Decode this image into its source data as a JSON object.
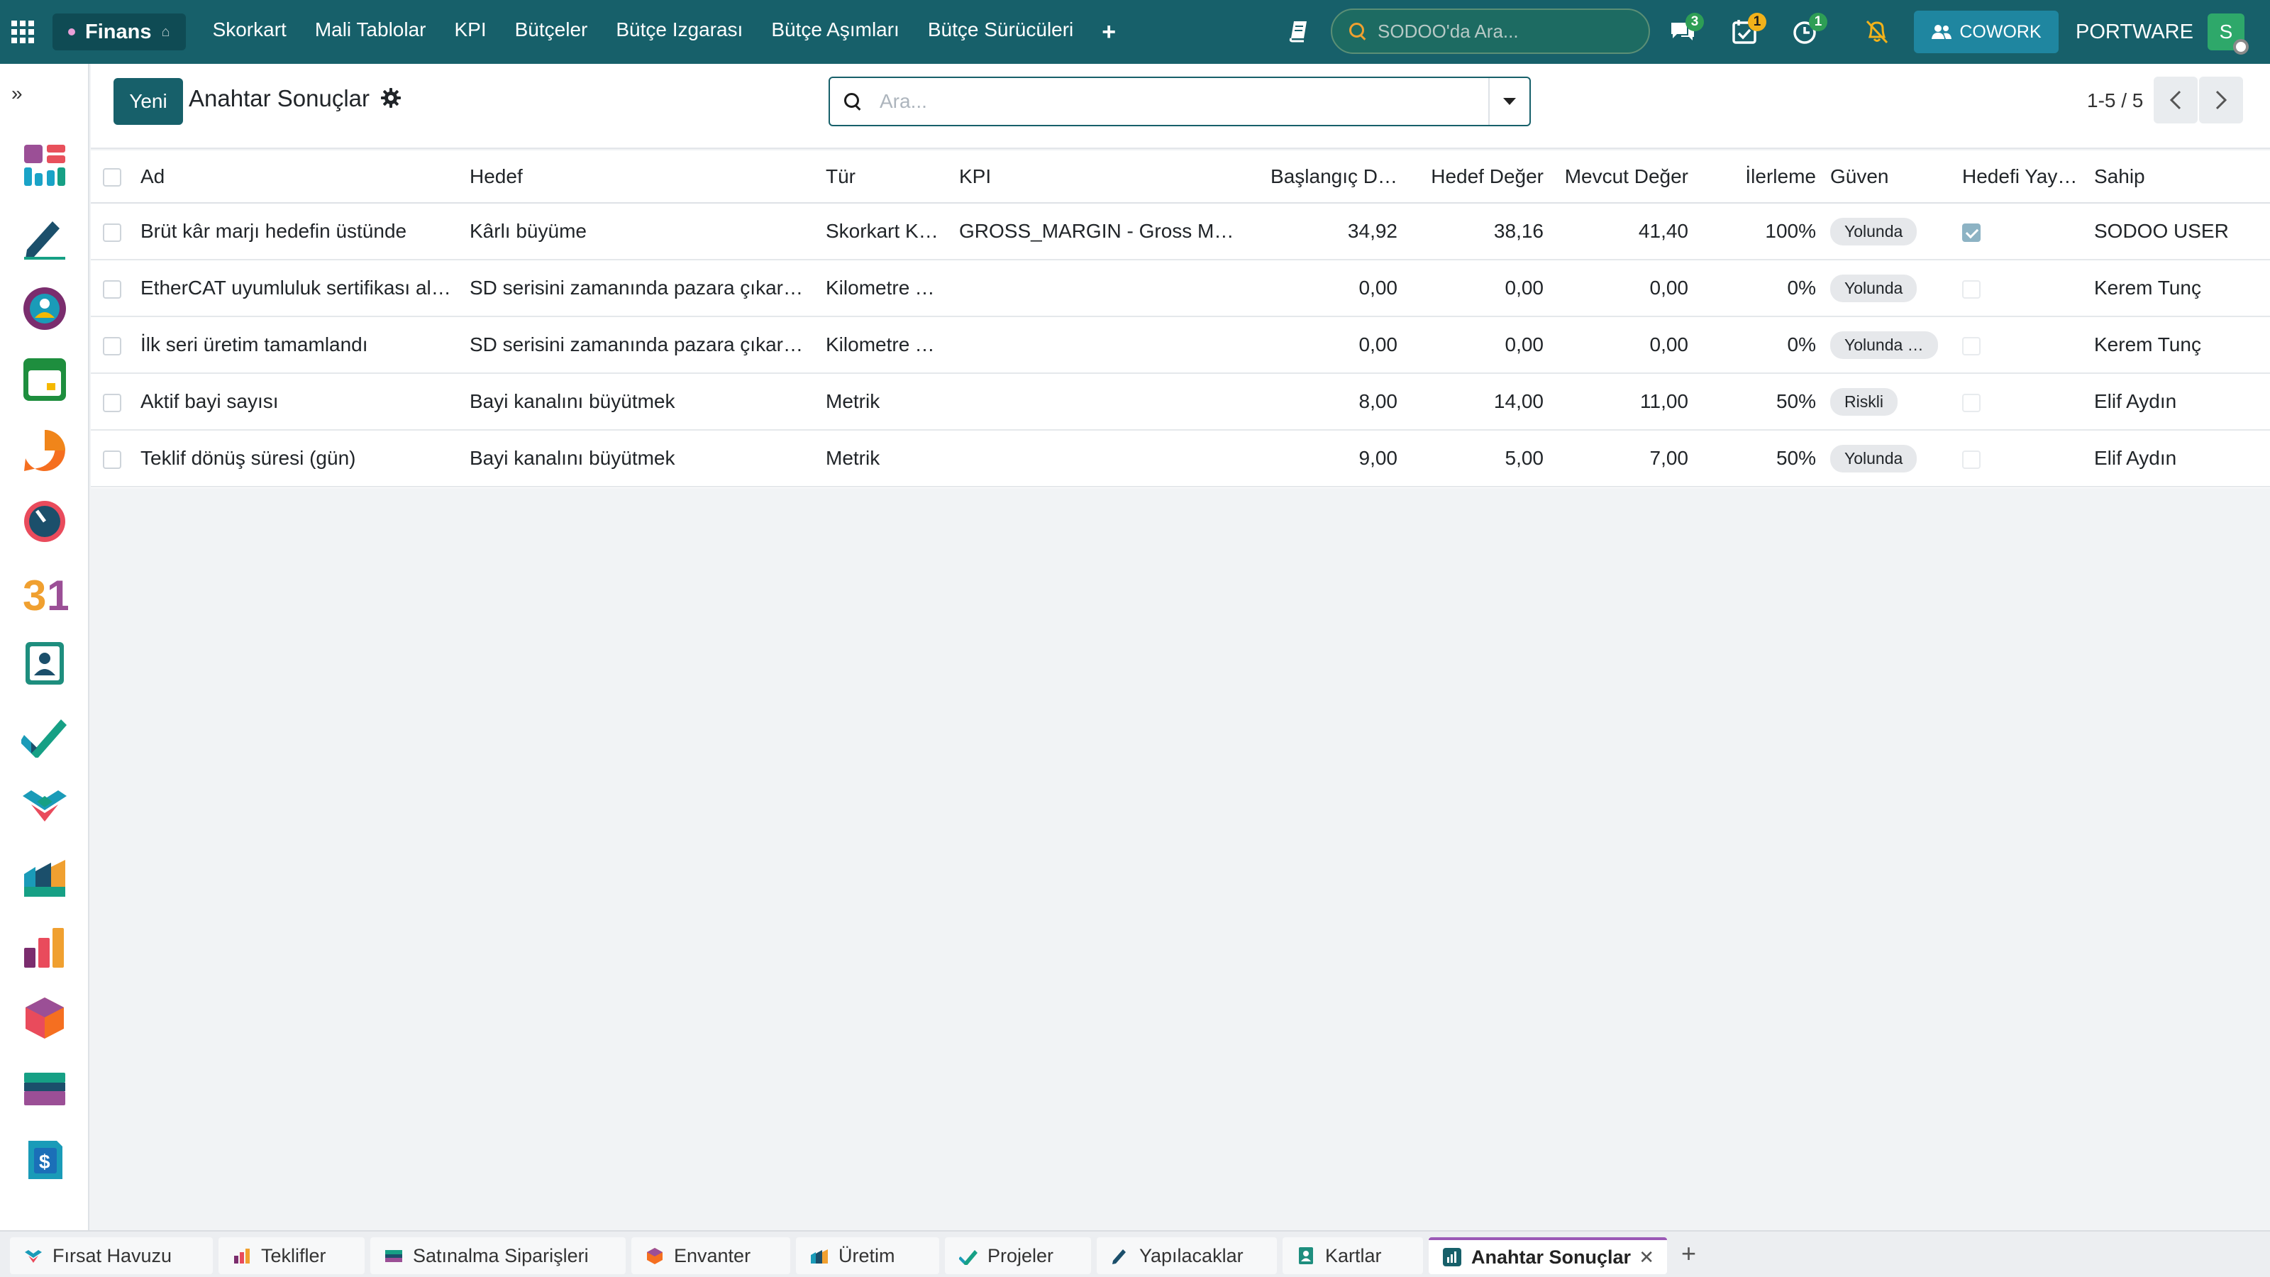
{
  "navbar": {
    "app_name": "Finans",
    "menu": [
      "Skorkart",
      "Mali Tablolar",
      "KPI",
      "Bütçeler",
      "Bütçe Izgarası",
      "Bütçe Aşımları",
      "Bütçe Sürücüleri"
    ],
    "search_placeholder": "SODOO'da Ara...",
    "badges": {
      "messages": "3",
      "activities": "1",
      "timer": "1"
    },
    "cowork_label": "COWORK",
    "company": "PORTWARE",
    "avatar_initial": "S",
    "accent_color": "#17606a"
  },
  "sidebar": {
    "apps": [
      "dashboard-app",
      "todo-app",
      "discuss-app",
      "calendar-app",
      "chat-app",
      "timesheet-app",
      "calendar-31-app",
      "contacts-app",
      "projects-app",
      "crm-app",
      "manufacturing-app",
      "reports-app",
      "inventory-app",
      "purchase-app",
      "invoicing-app"
    ]
  },
  "control": {
    "new_button": "Yeni",
    "title": "Anahtar Sonuçlar",
    "search_placeholder": "Ara...",
    "pager": "1-5 / 5"
  },
  "table": {
    "columns": [
      "Ad",
      "Hedef",
      "Tür",
      "KPI",
      "Başlangıç D…",
      "Hedef Değer",
      "Mevcut Değer",
      "İlerleme",
      "Güven",
      "Hedefi Yay…",
      "Sahip"
    ],
    "rows": [
      {
        "name": "Brüt kâr marjı hedefin üstünde",
        "goal": "Kârlı büyüme",
        "type": "Skorkart K…",
        "kpi": "GROSS_MARGIN - Gross Ma…",
        "start": "34,92",
        "target": "38,16",
        "current": "41,40",
        "progress": "100%",
        "confidence": "Yolunda",
        "achieved": true,
        "owner": "SODOO USER"
      },
      {
        "name": "EtherCAT uyumluluk sertifikası al…",
        "goal": "SD serisini zamanında pazara çıkar…",
        "type": "Kilometre T…",
        "kpi": "",
        "start": "0,00",
        "target": "0,00",
        "current": "0,00",
        "progress": "0%",
        "confidence": "Yolunda",
        "achieved": false,
        "owner": "Kerem Tunç"
      },
      {
        "name": "İlk seri üretim tamamlandı",
        "goal": "SD serisini zamanında pazara çıkar…",
        "type": "Kilometre T…",
        "kpi": "",
        "start": "0,00",
        "target": "0,00",
        "current": "0,00",
        "progress": "0%",
        "confidence": "Yolunda …",
        "achieved": false,
        "owner": "Kerem Tunç"
      },
      {
        "name": "Aktif bayi sayısı",
        "goal": "Bayi kanalını büyütmek",
        "type": "Metrik",
        "kpi": "",
        "start": "8,00",
        "target": "14,00",
        "current": "11,00",
        "progress": "50%",
        "confidence": "Riskli",
        "achieved": false,
        "owner": "Elif Aydın"
      },
      {
        "name": "Teklif dönüş süresi (gün)",
        "goal": "Bayi kanalını büyütmek",
        "type": "Metrik",
        "kpi": "",
        "start": "9,00",
        "target": "5,00",
        "current": "7,00",
        "progress": "50%",
        "confidence": "Yolunda",
        "achieved": false,
        "owner": "Elif Aydın"
      }
    ]
  },
  "taskbar": {
    "tabs": [
      "Fırsat Havuzu",
      "Teklifler",
      "Satınalma Siparişleri",
      "Envanter",
      "Üretim",
      "Projeler",
      "Yapılacaklar",
      "Kartlar",
      "Anahtar Sonuçlar"
    ]
  }
}
